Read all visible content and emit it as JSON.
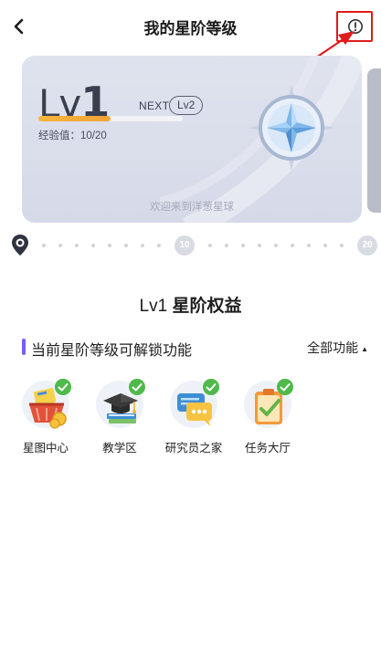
{
  "header": {
    "title": "我的星阶等级",
    "back_icon": "chevron-left-icon",
    "info_icon": "info-circle-icon"
  },
  "level_card": {
    "level_prefix": "Lv",
    "level_number": "1",
    "next_label": "NEXT",
    "next_level": "Lv2",
    "exp_label": "经验值：10/20",
    "exp_progress": 0.5,
    "welcome": "欢迎来到洋葱星球",
    "badge_icon": "four-point-star-badge-icon"
  },
  "track": {
    "markers": [
      "10",
      "20"
    ]
  },
  "benefits": {
    "level": "Lv1",
    "title": "星阶权益"
  },
  "section": {
    "label": "当前星阶等级可解锁功能",
    "all_label": "全部功能",
    "caret": "▲"
  },
  "features": [
    {
      "label": "星图中心",
      "icon": "treasure-basket-icon"
    },
    {
      "label": "教学区",
      "icon": "graduation-cap-icon"
    },
    {
      "label": "研究员之家",
      "icon": "chat-bubble-icon"
    },
    {
      "label": "任务大厅",
      "icon": "task-clipboard-icon"
    }
  ],
  "colors": {
    "accent": "#7c5cf6",
    "progress": "#f2a33a",
    "check": "#4fb94a",
    "annotation": "#e11b1b"
  }
}
